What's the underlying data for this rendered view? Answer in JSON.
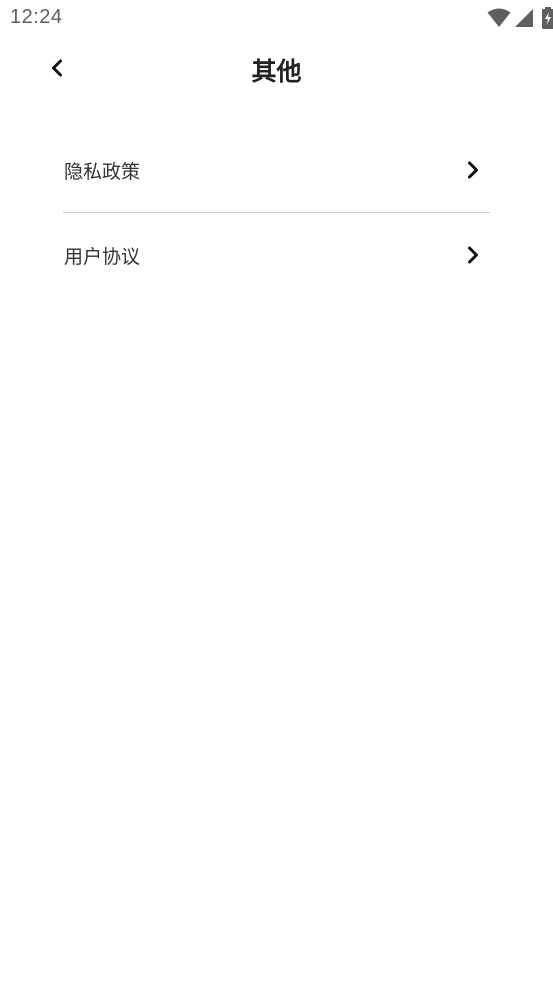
{
  "status_bar": {
    "time": "12:24",
    "icons": [
      "wifi-icon",
      "cellular-signal-icon",
      "battery-charging-icon"
    ]
  },
  "header": {
    "title": "其他",
    "back_icon": "chevron-left-icon"
  },
  "menu": {
    "items": [
      {
        "label": "隐私政策",
        "icon": "chevron-right-icon"
      },
      {
        "label": "用户协议",
        "icon": "chevron-right-icon"
      }
    ]
  },
  "colors": {
    "background": "#ffffff",
    "text": "#222222",
    "divider": "#cccccc",
    "status_text": "#5f5f5f"
  }
}
